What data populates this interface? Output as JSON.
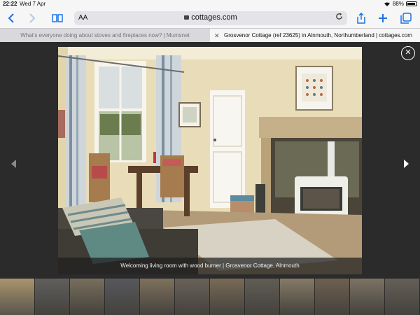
{
  "status": {
    "time": "22:22",
    "date": "Wed 7 Apr",
    "battery": "88%",
    "battery_level": 0.88
  },
  "toolbar": {
    "text_size_label": "AA",
    "host": "cottages.com",
    "icons": [
      "back-icon",
      "forward-icon",
      "bookmarks-icon",
      "reload-icon",
      "share-icon",
      "new-tab-icon",
      "tabs-icon"
    ]
  },
  "tabs": [
    {
      "label": "What's everyone doing about stoves and fireplaces now? | Mumsnet",
      "active": false
    },
    {
      "label": "Grosvenor Cottage (ref 23625) in Alnmouth, Northumberland | cottages.com",
      "active": true
    }
  ],
  "gallery": {
    "caption": "Welcoming living room with wood burner | Grosvenor Cottage, Alnmouth",
    "close_label": "✕",
    "thumbnail_count": 12,
    "selected_thumbnail": 1
  },
  "colors": {
    "accent": "#1a73e8",
    "viewer_bg": "#2b2b2b",
    "wall": "#ece0bd",
    "carpet": "#b39a78"
  }
}
